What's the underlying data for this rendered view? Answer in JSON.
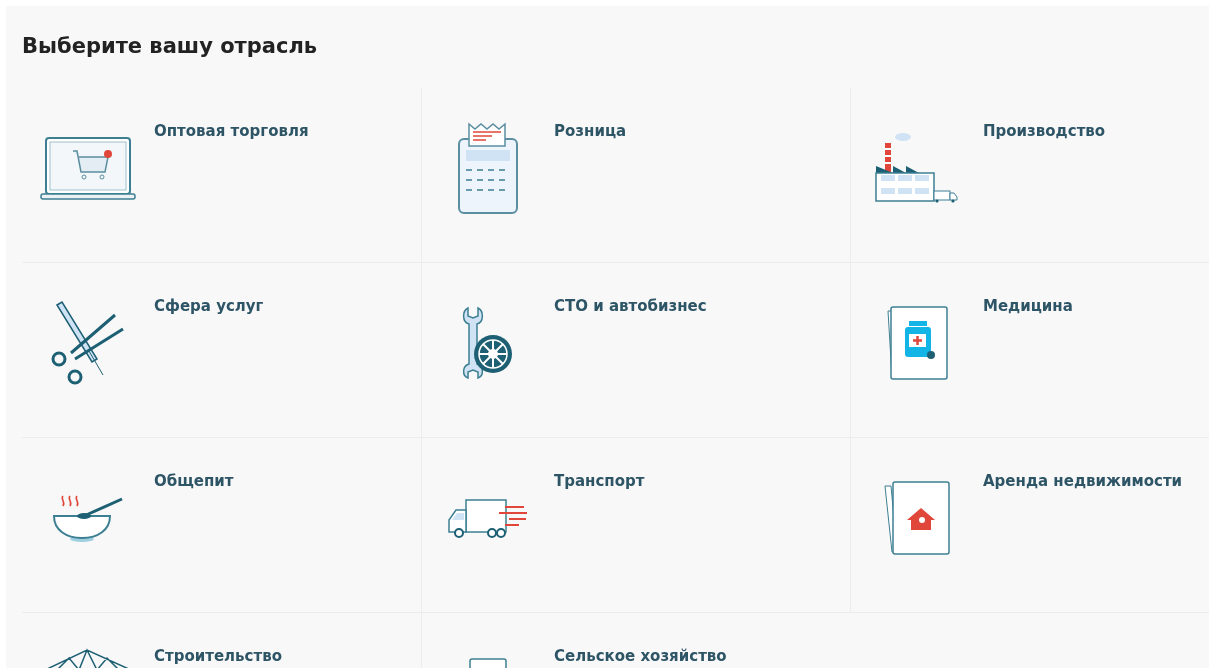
{
  "title": "Выберите вашу отрасль",
  "industries": [
    {
      "label": "Оптовая торговля",
      "kind": "wholesale"
    },
    {
      "label": "Розница",
      "kind": "retail"
    },
    {
      "label": "Производство",
      "kind": "factory"
    },
    {
      "label": "Сфера услуг",
      "kind": "salon"
    },
    {
      "label": "СТО и автобизнес",
      "kind": "autoservice"
    },
    {
      "label": "Медицина",
      "kind": "medicine"
    },
    {
      "label": "Общепит",
      "kind": "catering"
    },
    {
      "label": "Транспорт",
      "kind": "transport"
    },
    {
      "label": "Аренда недвижимости",
      "kind": "realty"
    },
    {
      "label": "Строительство",
      "kind": "construction"
    },
    {
      "label": "Сельское хозяйство",
      "kind": "agriculture"
    }
  ]
}
